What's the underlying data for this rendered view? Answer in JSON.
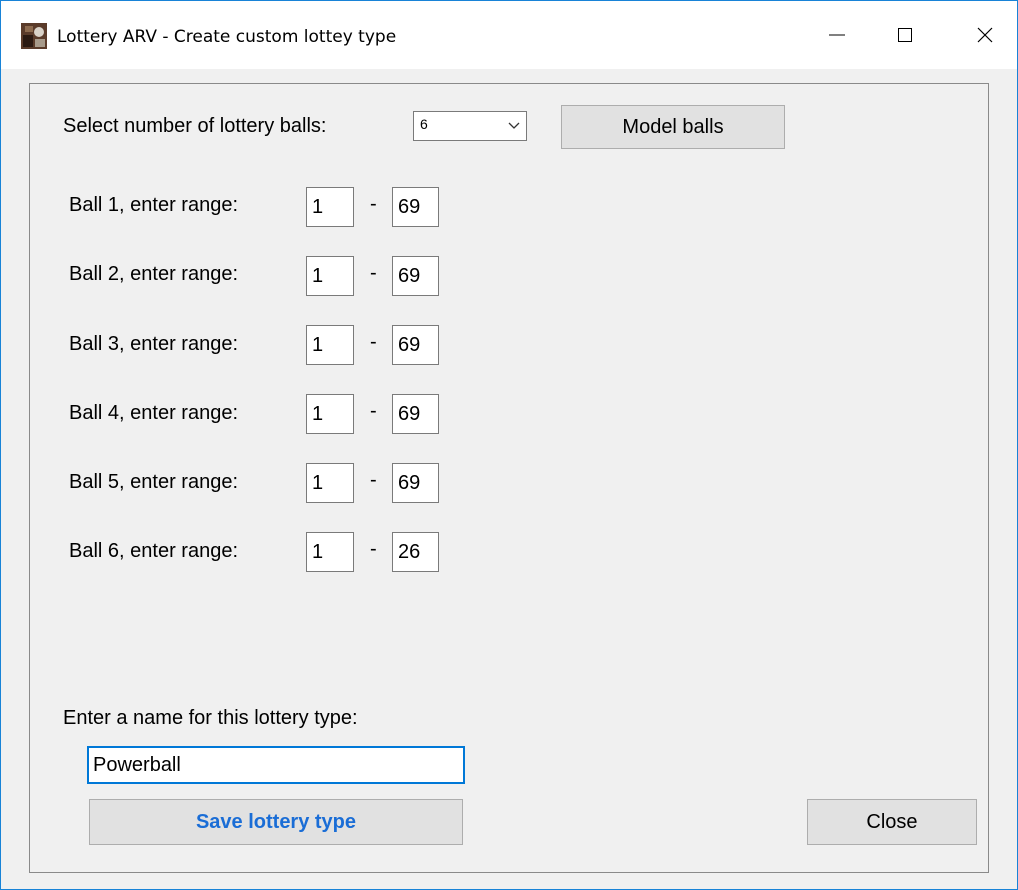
{
  "window": {
    "title": "Lottery ARV - Create custom lottey type",
    "icon": "app-icon",
    "controls": [
      "minimize-icon",
      "maximize-icon",
      "close-icon"
    ]
  },
  "ball_count": {
    "label": "Select number of lottery balls:",
    "selected": "6"
  },
  "model_button": "Model balls",
  "balls": [
    {
      "label": "Ball 1, enter range:",
      "min": "1",
      "sep": "-",
      "max": "69"
    },
    {
      "label": "Ball 2, enter range:",
      "min": "1",
      "sep": "-",
      "max": "69"
    },
    {
      "label": "Ball 3, enter range:",
      "min": "1",
      "sep": "-",
      "max": "69"
    },
    {
      "label": "Ball 4, enter range:",
      "min": "1",
      "sep": "-",
      "max": "69"
    },
    {
      "label": "Ball 5, enter range:",
      "min": "1",
      "sep": "-",
      "max": "69"
    },
    {
      "label": "Ball 6, enter range:",
      "min": "1",
      "sep": "-",
      "max": "26"
    }
  ],
  "name_section": {
    "label": "Enter a name for this lottery type:",
    "value": "Powerball"
  },
  "save_button": "Save lottery type",
  "close_button": "Close",
  "colors": {
    "save_text": "#1a6dd6",
    "focus_border": "#0078d7"
  }
}
